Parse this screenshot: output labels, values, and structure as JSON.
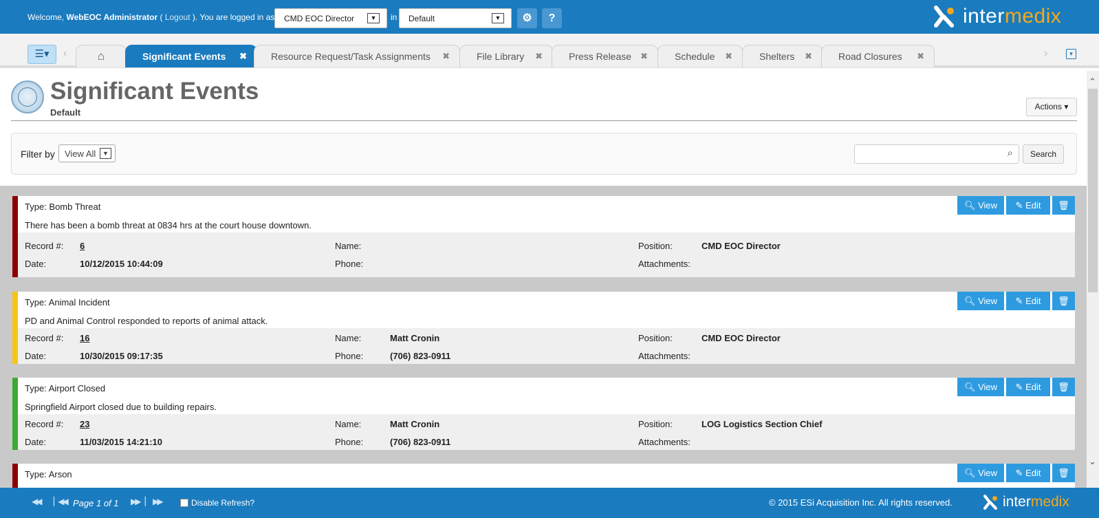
{
  "topbar": {
    "welcome_prefix": "Welcome, ",
    "user": "WebEOC Administrator",
    "logout": "Logout",
    "logged_in_text": "). You are logged in as",
    "paren_open": " ( ",
    "position_select": "CMD EOC Director",
    "in_text": "in",
    "incident_select": "Default",
    "brand_inter": "inter",
    "brand_medix": "medix"
  },
  "tabs": [
    {
      "label": "Significant Events",
      "active": true
    },
    {
      "label": "Resource Request/Task Assignments"
    },
    {
      "label": "File Library"
    },
    {
      "label": "Press Release"
    },
    {
      "label": "Schedule"
    },
    {
      "label": "Shelters"
    },
    {
      "label": "Road Closures"
    }
  ],
  "header": {
    "title": "Significant Events",
    "subtitle": "Default",
    "actions_label": "Actions"
  },
  "filter": {
    "label": "Filter by",
    "value": "View All",
    "search_placeholder": "",
    "search_button": "Search"
  },
  "labels": {
    "record": "Record #:",
    "date": "Date:",
    "name": "Name:",
    "phone": "Phone:",
    "position": "Position:",
    "attachments": "Attachments:",
    "view": "View",
    "edit": "Edit"
  },
  "events": [
    {
      "type": "Type: Bomb Threat",
      "desc": "There has been a bomb threat at 0834 hrs at the court house downtown.",
      "record": "6",
      "date": "10/12/2015 10:44:09",
      "name": "",
      "phone": "",
      "position": "CMD EOC Director",
      "attachments": "",
      "color": "#8b0000"
    },
    {
      "type": "Type: Animal Incident",
      "desc": "PD and Animal Control responded to reports of animal attack.",
      "record": "16",
      "date": "10/30/2015 09:17:35",
      "name": "Matt Cronin",
      "phone": "(706) 823-0911",
      "position": "CMD EOC Director",
      "attachments": "",
      "color": "#f5c518"
    },
    {
      "type": "Type: Airport Closed",
      "desc": "Springfield Airport closed due to building repairs.",
      "record": "23",
      "date": "11/03/2015 14:21:10",
      "name": "Matt Cronin",
      "phone": "(706) 823-0911",
      "position": "LOG Logistics Section Chief",
      "attachments": "",
      "color": "#3aaa35"
    },
    {
      "type": "Type: Arson",
      "color": "#8b0000"
    }
  ],
  "footer": {
    "page_text": "Page 1 of 1",
    "disable_refresh": "Disable Refresh?",
    "copyright": "© 2015 ESi Acquisition Inc. All rights reserved.",
    "brand_inter": "inter",
    "brand_medix": "medix"
  },
  "colors": {
    "brand_blue": "#1a7bbf",
    "brand_orange": "#f4a81c",
    "button_blue": "#2e9be0"
  }
}
